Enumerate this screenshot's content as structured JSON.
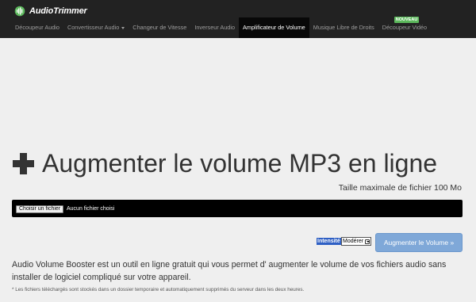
{
  "brand": {
    "name": "AudioTrimmer"
  },
  "nav": {
    "items": [
      {
        "label": "Découpeur Audio"
      },
      {
        "label": "Convertisseur Audio"
      },
      {
        "label": "Changeur de Vitesse"
      },
      {
        "label": "Inverseur Audio"
      },
      {
        "label": "Amplificateur de Volume"
      },
      {
        "label": "Musique Libre de Droits"
      },
      {
        "label": "Découpeur Vidéo"
      }
    ],
    "active_index": 4,
    "badge": "NOUVEAU",
    "badge_color": "#5cb85c",
    "bg_color": "#222222"
  },
  "main": {
    "title": "Augmenter le volume MP3 en ligne",
    "title_icon": "plus-icon",
    "max_size": "Taille maximale de fichier 100 Mo",
    "file_button": "Choisir un fichier",
    "file_status": "Aucun fichier choisi",
    "intensity_label": "Intensité",
    "intensity_value": "Modérer",
    "submit_label": "Augmenter le Volume »",
    "description": "Audio Volume Booster est un outil en ligne gratuit qui vous permet d' augmenter le volume de vos fichiers audio sans installer de logiciel compliqué sur votre appareil.",
    "note": "* Les fichiers téléchargés sont stockés dans un dossier temporaire et automatiquement supprimés du serveur dans les deux heures.",
    "accent_color": "#7fa8d8"
  }
}
